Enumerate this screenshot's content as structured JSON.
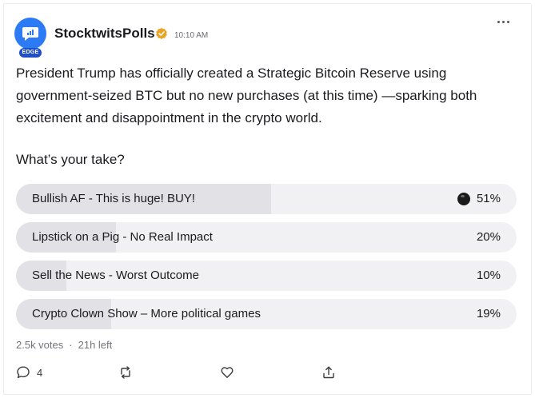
{
  "post": {
    "author": "StocktwitsPolls",
    "author_badge": "EDGE",
    "time": "10:10 AM",
    "body": "President Trump has officially created a Strategic Bitcoin Reserve using government-seized BTC but no new purchases (at this time) —sparking both excitement and disappointment in the crypto world.",
    "question": "What’s your take?"
  },
  "poll": {
    "options": [
      {
        "label": "Bullish AF - This is huge! BUY!",
        "percent_text": "51%",
        "percent": 51,
        "selected": true
      },
      {
        "label": "Lipstick on a Pig - No Real Impact",
        "percent_text": "20%",
        "percent": 20,
        "selected": false
      },
      {
        "label": "Sell the News - Worst Outcome",
        "percent_text": "10%",
        "percent": 10,
        "selected": false
      },
      {
        "label": "Crypto Clown Show – More political games",
        "percent_text": "19%",
        "percent": 19,
        "selected": false
      }
    ],
    "votes": "2.5k votes",
    "separator": "·",
    "time_left": "21h left"
  },
  "actions": {
    "comment_count": "4"
  },
  "icons": {
    "verified": "verified-badge-icon",
    "more": "more-options-icon",
    "comment": "comment-icon",
    "reshare": "reshare-icon",
    "like": "heart-icon",
    "share": "share-icon"
  },
  "colors": {
    "avatar": "#2d7bf4",
    "badge": "#1e4fc9",
    "verified": "#e8a422",
    "option_bg": "#f1f1f3",
    "option_fill": "#e2e2e6"
  }
}
